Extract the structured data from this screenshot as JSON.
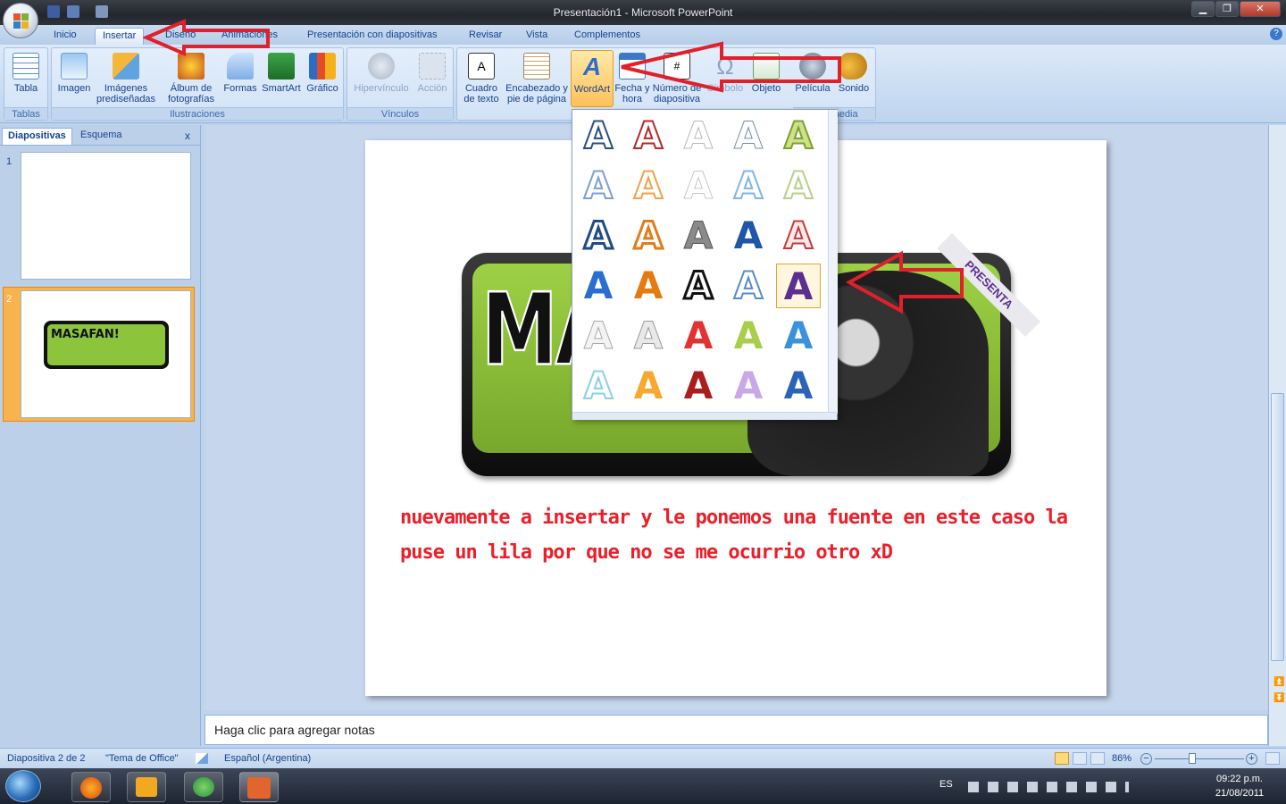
{
  "window": {
    "title": "Presentación1 - Microsoft PowerPoint",
    "min": "▁",
    "max": "❐",
    "close": "✕"
  },
  "tabs": [
    "Inicio",
    "Insertar",
    "Diseño",
    "Animaciones",
    "Presentación con diapositivas",
    "Revisar",
    "Vista",
    "Complementos"
  ],
  "ribbon": {
    "groups": [
      "Tablas",
      "Ilustraciones",
      "Vínculos",
      "Multimedia"
    ],
    "buttons": {
      "tabla": "Tabla",
      "imagen": "Imagen",
      "imagenes_prediseñadas": "Imágenes prediseñadas",
      "album": "Álbum de fotografías",
      "formas": "Formas",
      "smartart": "SmartArt",
      "grafico": "Gráfico",
      "hipervinculo": "Hipervínculo",
      "accion": "Acción",
      "cuadro_texto": "Cuadro de texto",
      "encabezado": "Encabezado y pie de página",
      "wordart": "WordArt",
      "fecha": "Fecha y hora",
      "numero": "Número de diapositiva",
      "simbolo": "Símbolo",
      "objeto": "Objeto",
      "pelicula": "Película",
      "sonido": "Sonido"
    }
  },
  "left_panel": {
    "tab_diapositivas": "Diapositivas",
    "tab_esquema": "Esquema",
    "close": "x",
    "slides": [
      "1",
      "2"
    ],
    "thumb_logo": "MASAFAN!"
  },
  "slide": {
    "logo_text": "MA",
    "badge": "PRESENTA",
    "body": "nuevamente a insertar y le ponemos una fuente en este caso la puse un lila por que no se me ocurrio otro xD"
  },
  "wordart_gallery": {
    "glyph": "A",
    "rows": 6,
    "cols": 5,
    "selected_row": 3,
    "selected_col": 4
  },
  "notes_placeholder": "Haga clic para agregar notas",
  "status": {
    "slide": "Diapositiva 2 de 2",
    "theme": "\"Tema de Office\"",
    "language": "Español (Argentina)",
    "zoom": "86%"
  },
  "taskbar": {
    "lang": "ES",
    "time": "09:22 p.m.",
    "date": "21/08/2011"
  },
  "colors": {
    "accent": "#e8202a",
    "selected_wordart": "#5c2e91",
    "ribbon": "#c6daf2"
  }
}
